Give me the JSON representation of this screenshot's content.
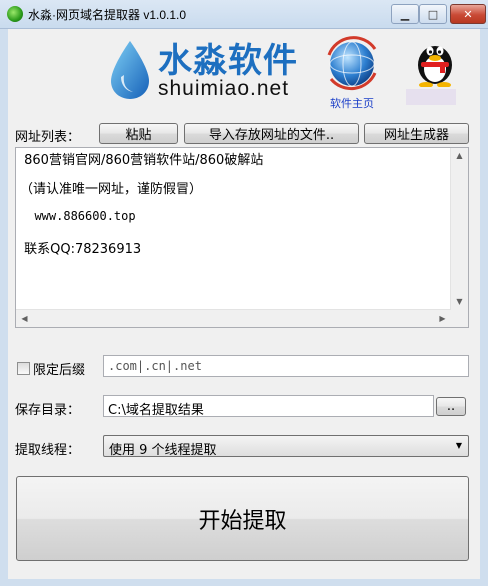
{
  "window": {
    "title": "水淼·网页域名提取器 v1.0.1.0",
    "min_glyph": "▁",
    "max_glyph": "□",
    "close_glyph": "✕"
  },
  "header": {
    "logo_cn": "水淼软件",
    "logo_en": "shuimiao.net",
    "home_link": "软件主页"
  },
  "url_list": {
    "label": "网址列表：",
    "paste_button": "粘贴",
    "import_button": "导入存放网址的文件..",
    "generator_button": "网址生成器",
    "lines": [
      " 860营销官网/860营销软件站/860破解站",
      "（请认准唯一网址，谨防假冒）",
      "  www.886600.top",
      " 联系QQ:78236913"
    ]
  },
  "suffix": {
    "checkbox_label": "限定后缀",
    "checked": false,
    "value": ".com|.cn|.net"
  },
  "save_dir": {
    "label": "保存目录：",
    "value": "C:\\域名提取结果",
    "browse_button": ".."
  },
  "threads": {
    "label": "提取线程：",
    "selected": "使用 9 个线程提取"
  },
  "start_button": "开始提取",
  "scroll": {
    "up": "▲",
    "down": "▼",
    "left": "◀",
    "right": "▶"
  }
}
